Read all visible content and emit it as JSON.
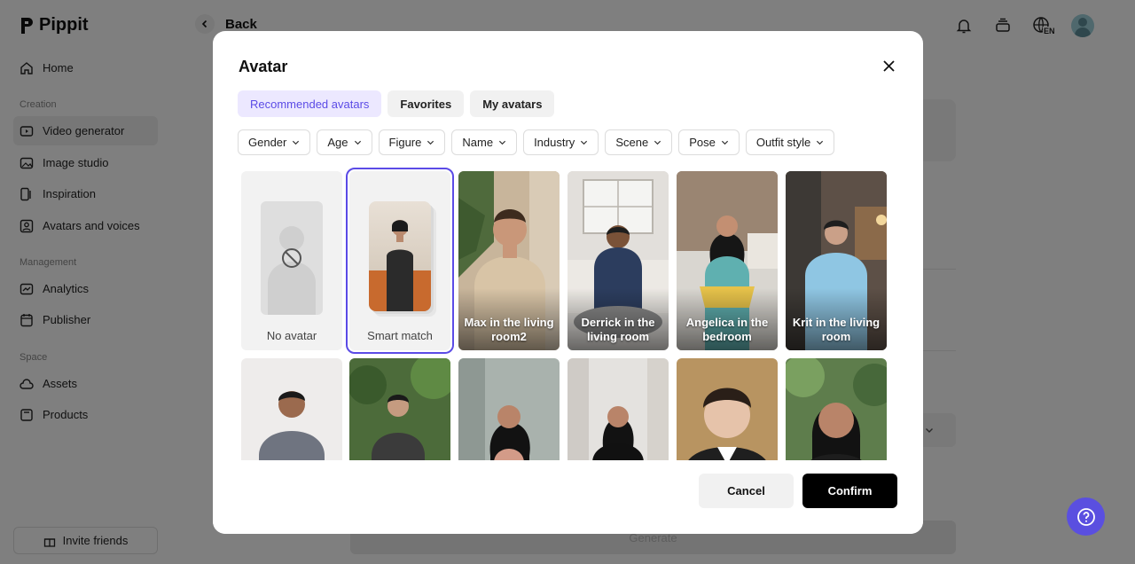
{
  "app": {
    "name": "Pippit"
  },
  "sidebar": {
    "items_main": [
      {
        "label": "Home",
        "icon": "home-icon"
      }
    ],
    "creation_label": "Creation",
    "creation_items": [
      {
        "label": "Video generator",
        "icon": "video-icon",
        "active": true
      },
      {
        "label": "Image studio",
        "icon": "image-icon"
      },
      {
        "label": "Inspiration",
        "icon": "inspiration-icon"
      },
      {
        "label": "Avatars and voices",
        "icon": "avatar-voice-icon"
      }
    ],
    "management_label": "Management",
    "management_items": [
      {
        "label": "Analytics",
        "icon": "analytics-icon"
      },
      {
        "label": "Publisher",
        "icon": "calendar-icon"
      }
    ],
    "space_label": "Space",
    "space_items": [
      {
        "label": "Assets",
        "icon": "cloud-icon"
      },
      {
        "label": "Products",
        "icon": "products-icon"
      }
    ],
    "invite_label": "Invite friends"
  },
  "topbar": {
    "back_label": "Back",
    "language": "EN"
  },
  "background": {
    "generate_label": "Generate"
  },
  "modal": {
    "title": "Avatar",
    "tabs": [
      {
        "label": "Recommended avatars",
        "active": true
      },
      {
        "label": "Favorites"
      },
      {
        "label": "My avatars"
      }
    ],
    "filters": [
      "Gender",
      "Age",
      "Figure",
      "Name",
      "Industry",
      "Scene",
      "Pose",
      "Outfit style"
    ],
    "avatars_row1": [
      {
        "label": "No avatar"
      },
      {
        "label": "Smart match",
        "selected": true
      },
      {
        "label": "Max in the living room2"
      },
      {
        "label": "Derrick in the living room"
      },
      {
        "label": "Angelica in the bedroom"
      },
      {
        "label": "Krit in the living room"
      }
    ],
    "cancel_label": "Cancel",
    "confirm_label": "Confirm"
  },
  "colors": {
    "accent": "#5b4be6",
    "accent_bg": "#ece8ff",
    "confirm_bg": "#000000",
    "help_fab": "#5a4fe0"
  }
}
